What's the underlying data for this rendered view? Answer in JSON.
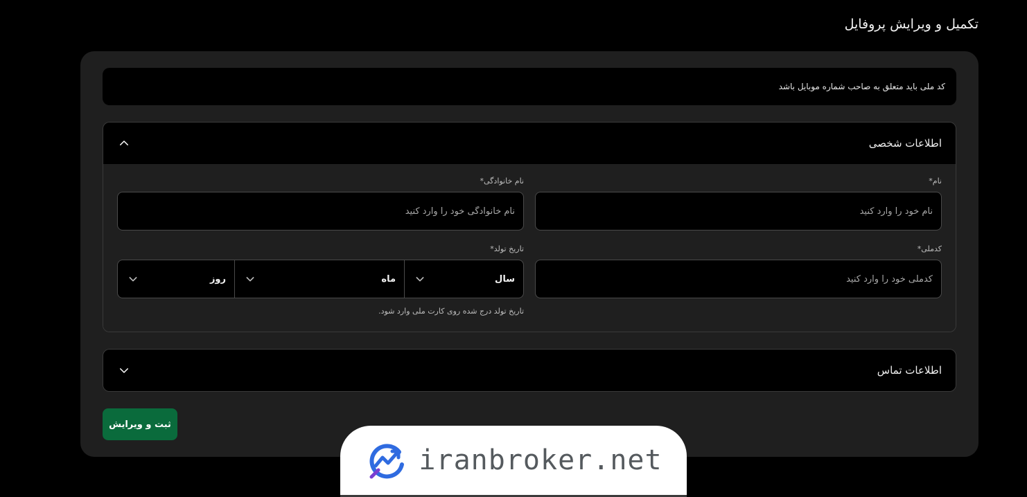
{
  "page": {
    "title": "تکمیل و ویرایش پروفایل"
  },
  "notice": {
    "text": "کد ملی باید متعلق به صاحب شماره موبایل باشد"
  },
  "personal": {
    "title": "اطلاعات شخصی",
    "fields": {
      "first_name": {
        "label": "نام*",
        "placeholder": "نام خود را وارد کنید",
        "value": ""
      },
      "last_name": {
        "label": "نام خانوادگی*",
        "placeholder": "نام خانوادگی خود را وارد کنید",
        "value": ""
      },
      "national_id": {
        "label": "کدملی*",
        "placeholder": "کدملی خود را وارد کنید",
        "value": ""
      },
      "birth_date": {
        "label": "تاریخ تولد*",
        "year": "سال",
        "month": "ماه",
        "day": "روز",
        "hint": "تاریخ تولد درج شده روی کارت ملی وارد شود."
      }
    }
  },
  "contact": {
    "title": "اطلاعات تماس"
  },
  "actions": {
    "submit_label": "ثبت و ویرایش"
  },
  "watermark": {
    "text": "iranbroker.net"
  },
  "icons": {
    "collapse": "chevron-up-icon",
    "expand": "chevron-down-icon",
    "dropdown": "chevron-down-icon",
    "brand": "trend-arrow-logo-icon"
  },
  "colors": {
    "background": "#000000",
    "card": "#1f1f1f",
    "accent_button": "#0a6b3c",
    "logo_blue": "#2f6be0",
    "watermark_text": "#555a5e"
  }
}
